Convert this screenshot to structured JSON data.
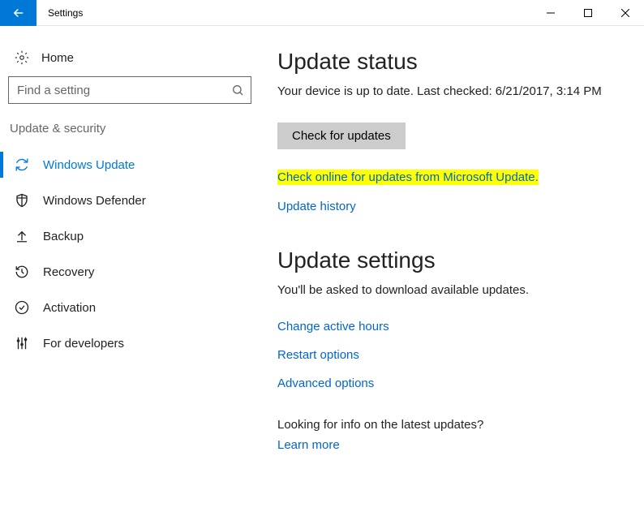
{
  "titlebar": {
    "title": "Settings"
  },
  "sidebar": {
    "home": "Home",
    "search_placeholder": "Find a setting",
    "category": "Update & security",
    "items": [
      {
        "label": "Windows Update"
      },
      {
        "label": "Windows Defender"
      },
      {
        "label": "Backup"
      },
      {
        "label": "Recovery"
      },
      {
        "label": "Activation"
      },
      {
        "label": "For developers"
      }
    ]
  },
  "main": {
    "status_heading": "Update status",
    "status_text": "Your device is up to date. Last checked: 6/21/2017, 3:14 PM",
    "check_button": "Check for updates",
    "check_online_link": "Check online for updates from Microsoft Update.",
    "history_link": "Update history",
    "settings_heading": "Update settings",
    "settings_text": "You'll be asked to download available updates.",
    "active_hours_link": "Change active hours",
    "restart_link": "Restart options",
    "advanced_link": "Advanced options",
    "looking_text": "Looking for info on the latest updates?",
    "learn_more_link": "Learn more"
  }
}
